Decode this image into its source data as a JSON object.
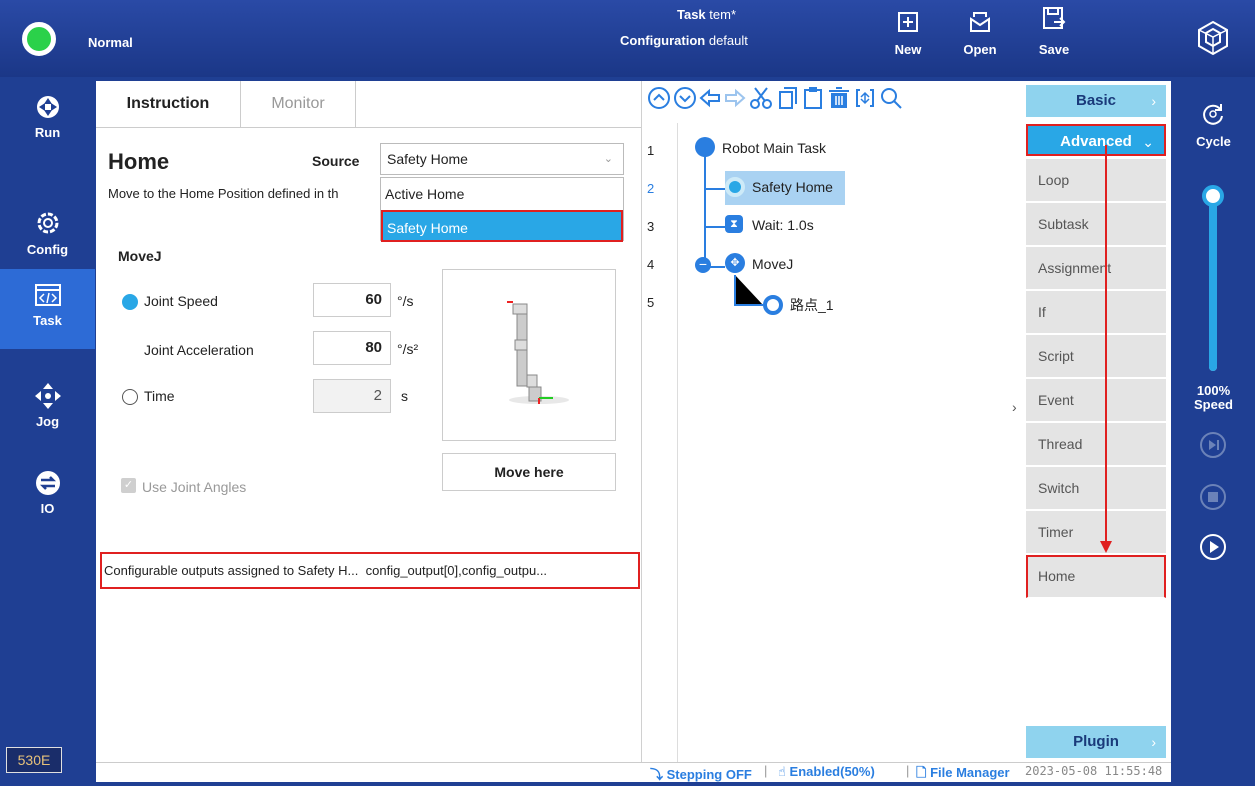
{
  "topbar": {
    "status": "Normal",
    "task_label": "Task",
    "task_value": "tem*",
    "config_label": "Configuration",
    "config_value": "default",
    "new_label": "New",
    "open_label": "Open",
    "save_label": "Save"
  },
  "leftnav": {
    "run": "Run",
    "config": "Config",
    "task": "Task",
    "jog": "Jog",
    "io": "IO",
    "version": "530E"
  },
  "tabs": {
    "instruction": "Instruction",
    "monitor": "Monitor"
  },
  "home": {
    "title": "Home",
    "source_label": "Source",
    "source_value": "Safety Home",
    "description": "Move to the Home Position defined in th",
    "options": [
      "Active Home",
      "Safety Home"
    ],
    "movej_label": "MoveJ",
    "joint_speed_label": "Joint Speed",
    "joint_speed_value": "60",
    "joint_speed_unit": "°/s",
    "joint_acc_label": "Joint Acceleration",
    "joint_acc_value": "80",
    "joint_acc_unit": "°/s²",
    "time_label": "Time",
    "time_value": "2",
    "time_unit": "s",
    "use_joint_angles": "Use Joint Angles",
    "move_here": "Move here",
    "info_label": "Configurable outputs assigned to Safety H...",
    "info_value": "config_output[0],config_outpu..."
  },
  "tree": {
    "lines": [
      "1",
      "2",
      "3",
      "4",
      "5"
    ],
    "nodes": [
      "Robot Main Task",
      "Safety Home",
      "Wait: 1.0s",
      "MoveJ",
      "路点_1"
    ]
  },
  "palette": {
    "basic": "Basic",
    "advanced": "Advanced",
    "items": [
      "Loop",
      "Subtask",
      "Assignment",
      "If",
      "Script",
      "Event",
      "Thread",
      "Switch",
      "Timer",
      "Home"
    ],
    "plugin": "Plugin"
  },
  "rightnav": {
    "cycle": "Cycle",
    "speed_value": "100%",
    "speed_label": "Speed"
  },
  "speed_fraction": 1.0,
  "bottombar": {
    "stepping": "Stepping OFF",
    "enabled": "Enabled(50%)",
    "file_manager": "File Manager",
    "datetime": "2023-05-08 11:55:48"
  }
}
